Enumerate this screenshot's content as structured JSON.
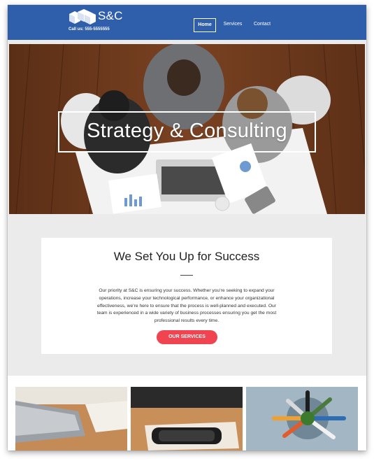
{
  "header": {
    "brand": "S&C",
    "tagline": "Call us: 555-5555555",
    "nav": [
      {
        "label": "Home",
        "active": true
      },
      {
        "label": "Services",
        "active": false
      },
      {
        "label": "Contact",
        "active": false
      }
    ]
  },
  "hero": {
    "title": "Strategy & Consulting"
  },
  "intro": {
    "title": "We Set You Up for Success",
    "body": "Our priority at S&C is ensuring your success. Whether you’re seeking to expand your operations, increase your technological performance, or enhance your organizational effectiveness, we’re here to ensure that the process is well-planned and executed. Our team is experienced in a wide variety of business processes ensuring you get the most professional results every time.",
    "cta_label": "OUR SERVICES"
  },
  "colors": {
    "header_bg": "#2f5faa",
    "cta_bg": "#f04450",
    "page_bg": "#ebebeb"
  }
}
